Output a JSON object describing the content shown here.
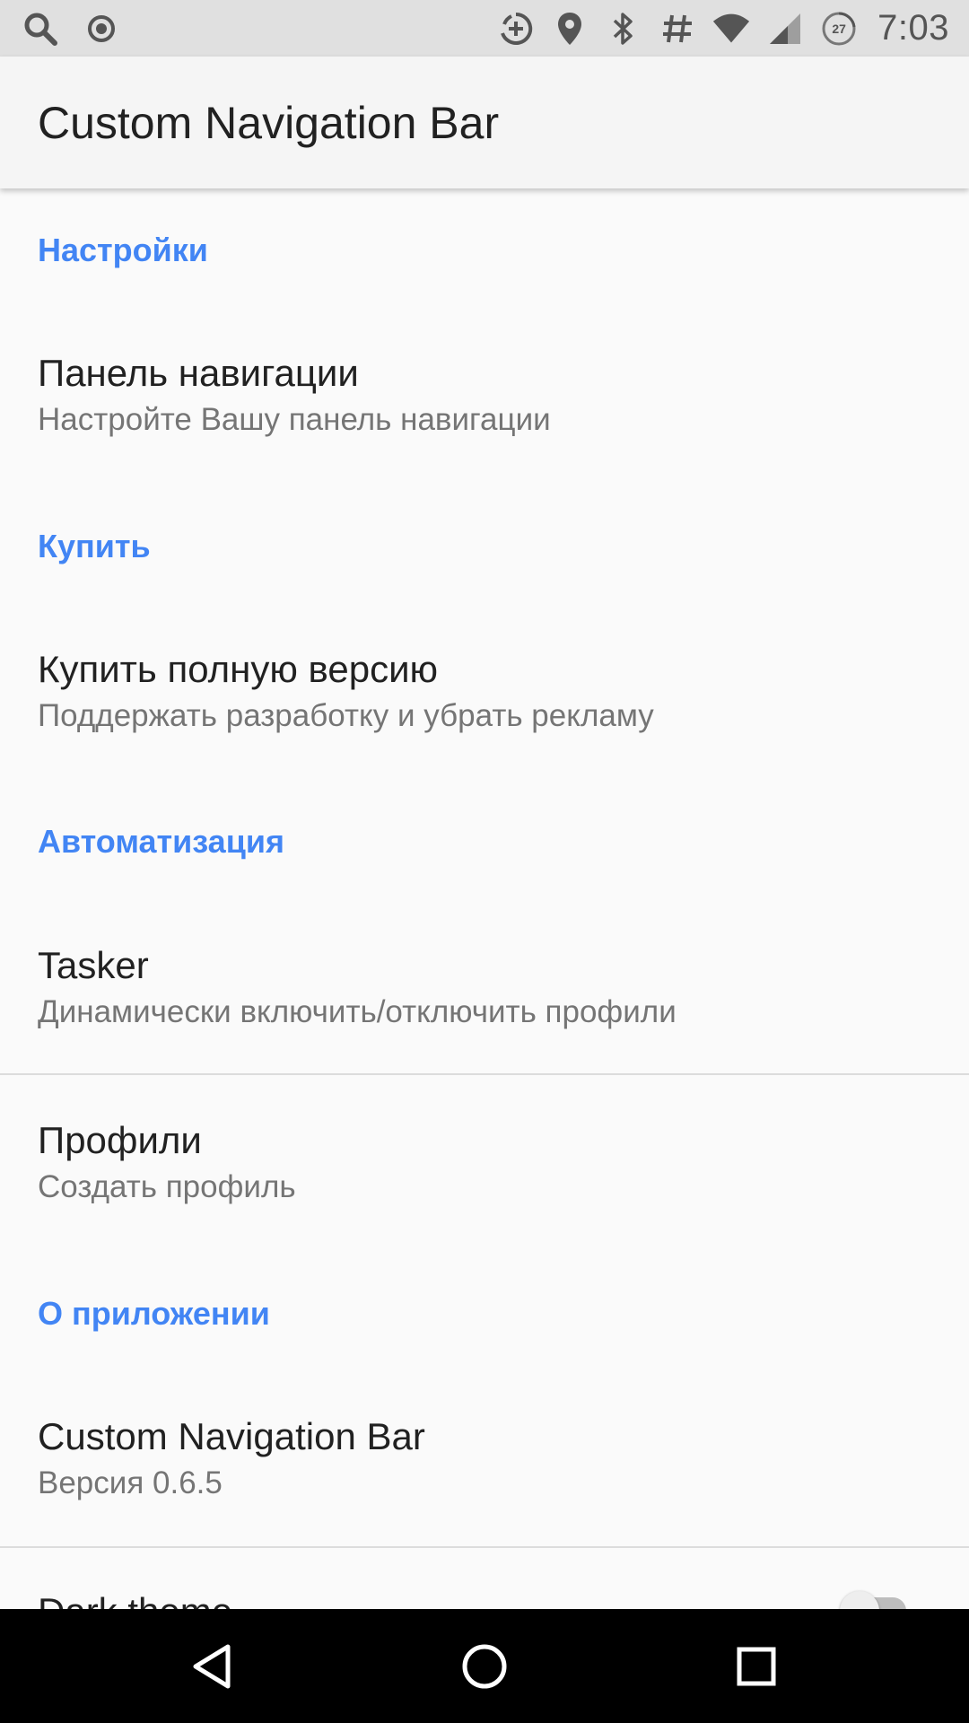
{
  "status_bar": {
    "time": "7:03",
    "left_icons": [
      "search-icon",
      "record-icon"
    ],
    "right_icons": [
      "data-saver-icon",
      "location-icon",
      "bluetooth-icon",
      "hash-icon",
      "wifi-icon",
      "signal-icon",
      "battery-icon"
    ],
    "battery_level_text": "27"
  },
  "app_bar": {
    "title": "Custom Navigation Bar"
  },
  "sections": {
    "settings": {
      "header": "Настройки",
      "navbar_pref": {
        "title": "Панель навигации",
        "summary": "Настройте Вашу панель навигации"
      }
    },
    "buy": {
      "header": "Купить",
      "full_version_pref": {
        "title": "Купить полную версию",
        "summary": "Поддержать разработку и убрать рекламу"
      }
    },
    "automation": {
      "header": "Автоматизация",
      "tasker_pref": {
        "title": "Tasker",
        "summary": "Динамически включить/отключить профили"
      },
      "profiles_pref": {
        "title": "Профили",
        "summary": "Создать профиль"
      }
    },
    "about": {
      "header": "О приложении",
      "app_pref": {
        "title": "Custom Navigation Bar",
        "summary": "Версия 0.6.5"
      },
      "dark_theme_pref": {
        "title": "Dark theme",
        "enabled": false
      }
    }
  },
  "colors": {
    "accent": "#4285f4",
    "status_bar": "#e0e0e0",
    "background": "#fafafa",
    "navbar": "#000000"
  },
  "nav_buttons": [
    "back-icon",
    "home-icon",
    "recents-icon"
  ]
}
